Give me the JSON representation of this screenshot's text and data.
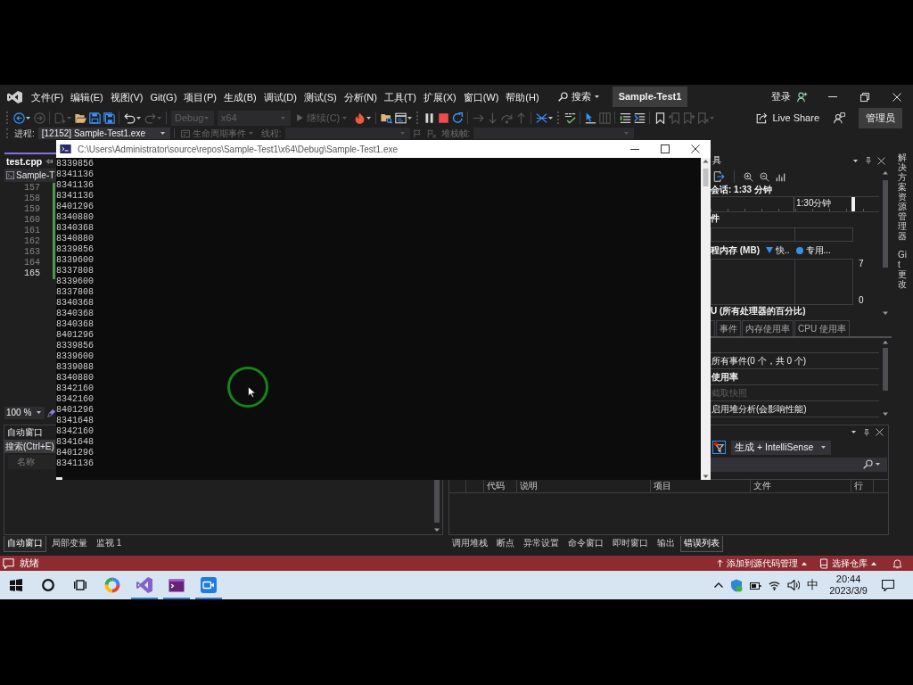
{
  "title_bar": {
    "menu": [
      "文件(F)",
      "编辑(E)",
      "视图(V)",
      "Git(G)",
      "项目(P)",
      "生成(B)",
      "调试(D)",
      "测试(S)",
      "分析(N)",
      "工具(T)",
      "扩展(X)",
      "窗口(W)",
      "帮助(H)"
    ],
    "search": "搜索",
    "solution": "Sample-Test1",
    "sign_in": "登录"
  },
  "toolbar": {
    "buttons": [
      {
        "disabled": false
      },
      {
        "disabled": true
      },
      {
        "disabled": true
      },
      {
        "disabled": false
      },
      {
        "disabled": false
      },
      {
        "disabled": false
      },
      {
        "disabled": false
      },
      {
        "disabled": true
      },
      {
        "disabled": false
      },
      {
        "disabled": false
      },
      {
        "disabled": false
      },
      {
        "disabled": false
      },
      {
        "disabled": false
      },
      {
        "disabled": false
      },
      {
        "disabled": true
      },
      {
        "disabled": true
      },
      {
        "disabled": true
      },
      {
        "disabled": true
      },
      {
        "disabled": false
      },
      {
        "disabled": false
      },
      {
        "disabled": false
      },
      {
        "disabled": true
      },
      {
        "disabled": false
      },
      {
        "disabled": false
      },
      {
        "disabled": false
      },
      {
        "disabled": true
      },
      {
        "disabled": true
      },
      {
        "disabled": true
      }
    ],
    "configuration": {
      "value": "Debug",
      "disabled": true
    },
    "platform": {
      "value": "x64",
      "disabled": true
    },
    "continue": {
      "label": "继续(C)",
      "disabled": true
    },
    "live_share": "Live Share",
    "role": "管理员"
  },
  "debug_location": {
    "process_label": "进程:",
    "process": "[12152] Sample-Test1.exe",
    "lifecycle_events": "生命周期事件",
    "thread_label": "线程:",
    "stack_frame_label": "堆栈帧:"
  },
  "editor": {
    "tabs": [
      {
        "label": "test.cpp",
        "selected": true
      }
    ],
    "scope": "Sample-T",
    "lines": [
      {
        "number": "157",
        "current": false
      },
      {
        "number": "158",
        "current": false
      },
      {
        "number": "159",
        "current": false
      },
      {
        "number": "160",
        "current": false
      },
      {
        "number": "161",
        "current": false
      },
      {
        "number": "162",
        "current": false
      },
      {
        "number": "163",
        "current": false
      },
      {
        "number": "164",
        "current": false
      },
      {
        "number": "165",
        "current": true
      }
    ],
    "zoom": "100 %"
  },
  "console": {
    "title": "C:\\Users\\Administrator\\source\\repos\\Sample-Test1\\x64\\Debug\\Sample-Test1.exe",
    "lines": [
      "8339856",
      "8341136",
      "8341136",
      "8341136",
      "8401296",
      "8340880",
      "8340368",
      "8340880",
      "8339856",
      "8339600",
      "8337808",
      "8339600",
      "8337808",
      "8340368",
      "8340368",
      "8340368",
      "8401296",
      "8339856",
      "8339600",
      "8339088",
      "8340880",
      "8342160",
      "8342160",
      "8401296",
      "8341648",
      "8342160",
      "8341648",
      "8401296",
      "8341136"
    ]
  },
  "diagnostics": {
    "title": "具",
    "session": "会话: 1:33 分钟",
    "timeline_label": "1:30分钟",
    "events_label": "件",
    "memory_label": "程内存 (MB)",
    "legend": [
      {
        "label": "快..",
        "kind": "triangle"
      },
      {
        "label": "专用...",
        "kind": "dot"
      }
    ],
    "memory_axis_max": "7",
    "memory_axis_min": "0",
    "cpu_label": "U (所有处理器的百分比)",
    "tabs": [
      {
        "label": "事件",
        "selected": false
      },
      {
        "label": "内存使用率",
        "selected": false
      },
      {
        "label": "CPU 使用率",
        "selected": false
      }
    ],
    "summary": [
      {
        "kind": "text",
        "text": "所有事件(0 个，共 0 个)",
        "disabled": false
      },
      {
        "kind": "heading",
        "text": "使用率",
        "disabled": false
      },
      {
        "kind": "link",
        "text": "截取快照",
        "disabled": true
      },
      {
        "kind": "text",
        "text": "启用堆分析(会影响性能)",
        "disabled": false
      }
    ]
  },
  "side_tabs": [
    "解决方案资源管理器",
    "Git 更改"
  ],
  "autos": {
    "title": "自动窗口",
    "search_placeholder": "搜索(Ctrl+E)",
    "columns": [
      "名称"
    ]
  },
  "error_list": {
    "scope": "生成 + IntelliSense",
    "columns": [
      "代码",
      "说明",
      "项目",
      "文件",
      "行"
    ]
  },
  "bottom_tabs_left": [
    {
      "label": "自动窗口",
      "selected": true
    },
    {
      "label": "局部变量",
      "selected": false
    },
    {
      "label": "监视 1",
      "selected": false
    }
  ],
  "bottom_tabs_right": [
    {
      "label": "调用堆栈",
      "selected": false
    },
    {
      "label": "断点",
      "selected": false
    },
    {
      "label": "异常设置",
      "selected": false
    },
    {
      "label": "命令窗口",
      "selected": false
    },
    {
      "label": "即时窗口",
      "selected": false
    },
    {
      "label": "输出",
      "selected": false
    },
    {
      "label": "错误列表",
      "selected": true
    }
  ],
  "status_bar": {
    "text": "就绪",
    "source_control": "添加到源代码管理",
    "repository": "选择仓库"
  },
  "taskbar": {
    "apps": [
      {
        "running": false
      },
      {
        "running": true
      },
      {
        "running": true
      },
      {
        "running": true
      }
    ],
    "input_method": "中",
    "time": "20:44",
    "date": "2023/3/9"
  }
}
